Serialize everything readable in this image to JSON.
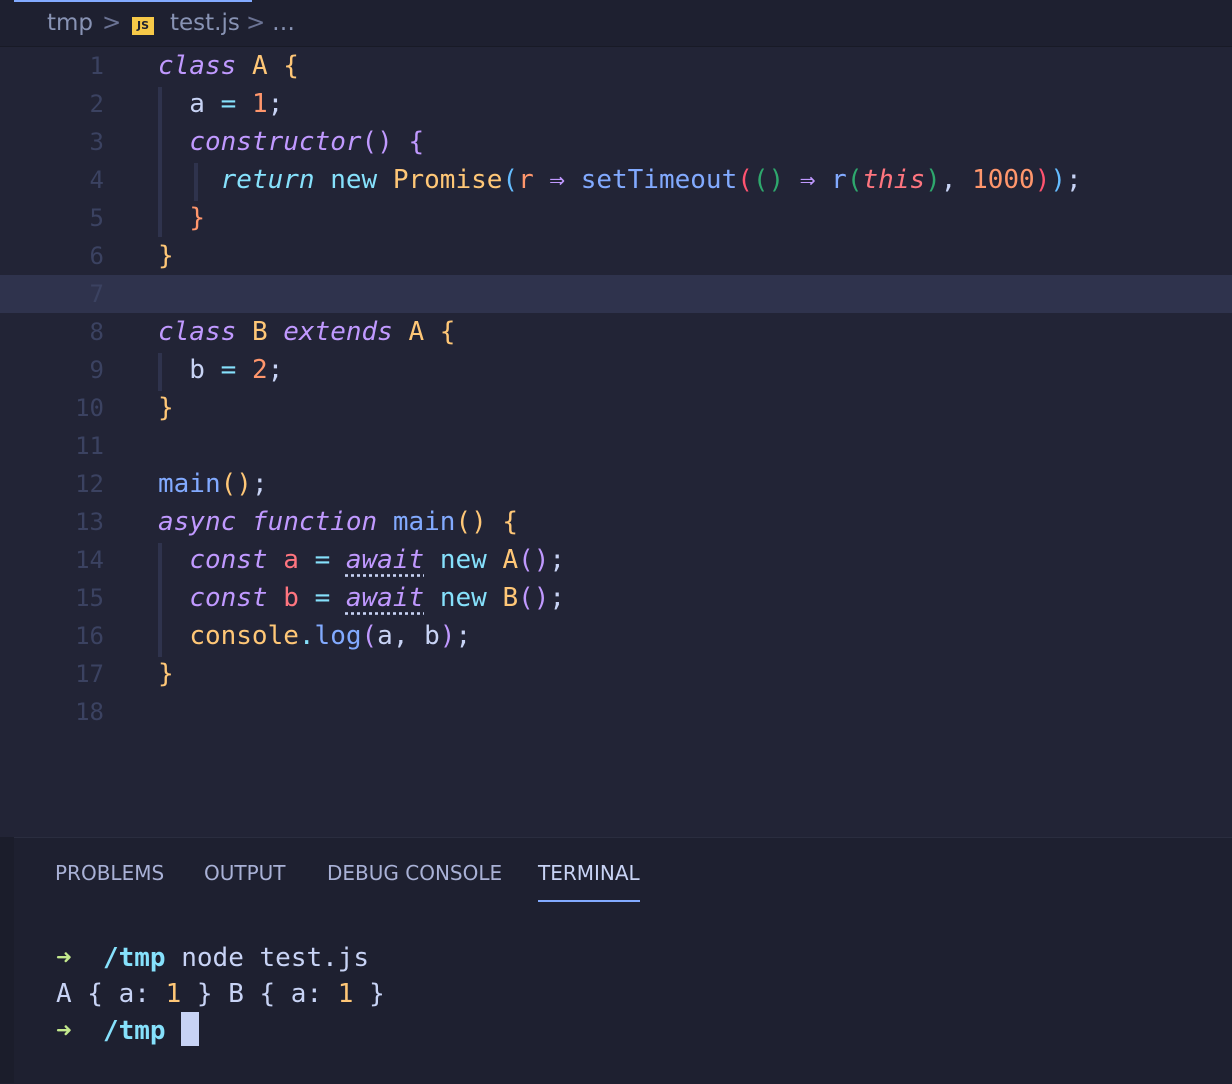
{
  "breadcrumb": {
    "folder": "tmp",
    "sep": ">",
    "file_icon": "JS",
    "file": "test.js",
    "more": "…"
  },
  "editor": {
    "line_numbers": [
      "1",
      "2",
      "3",
      "4",
      "5",
      "6",
      "7",
      "8",
      "9",
      "10",
      "11",
      "12",
      "13",
      "14",
      "15",
      "16",
      "17",
      "18"
    ],
    "current_line": 7,
    "code": {
      "l1": {
        "t1": "class",
        "t2": " ",
        "t3": "A",
        "t4": " ",
        "t5": "{"
      },
      "l2": {
        "t1": "  a ",
        "t2": "=",
        "t3": " ",
        "t4": "1",
        "t5": ";"
      },
      "l3": {
        "t1": "  ",
        "t2": "constructor",
        "t3": "(",
        "t4": ")",
        "t5": " ",
        "t6": "{"
      },
      "l4": {
        "t1": "    ",
        "t2": "return",
        "t3": " ",
        "t4": "new",
        "t5": " ",
        "t6": "Promise",
        "t7": "(",
        "t8": "r",
        "t9": " ",
        "t10": "⇒",
        "t11": " ",
        "t12": "setTimeout",
        "t13": "(",
        "t14": "(",
        "t15": ")",
        "t16": " ",
        "t17": "⇒",
        "t18": " ",
        "t19": "r",
        "t20": "(",
        "t21": "this",
        "t22": ")",
        "t23": ", ",
        "t24": "1000",
        "t25": ")",
        "t26": ")",
        "t27": ";"
      },
      "l5": {
        "t1": "  ",
        "t2": "}"
      },
      "l6": {
        "t1": "}"
      },
      "l8": {
        "t1": "class",
        "t2": " ",
        "t3": "B",
        "t4": " ",
        "t5": "extends",
        "t6": " ",
        "t7": "A",
        "t8": " ",
        "t9": "{"
      },
      "l9": {
        "t1": "  b ",
        "t2": "=",
        "t3": " ",
        "t4": "2",
        "t5": ";"
      },
      "l10": {
        "t1": "}"
      },
      "l12": {
        "t1": "main",
        "t2": "(",
        "t3": ")",
        "t4": ";"
      },
      "l13": {
        "t1": "async",
        "t2": " ",
        "t3": "function",
        "t4": " ",
        "t5": "main",
        "t6": "(",
        "t7": ")",
        "t8": " ",
        "t9": "{"
      },
      "l14": {
        "t1": "  ",
        "t2": "const",
        "t3": " ",
        "t4": "a",
        "t5": " ",
        "t6": "=",
        "t7": " ",
        "t8": "await",
        "t9": " ",
        "t10": "new",
        "t11": " ",
        "t12": "A",
        "t13": "(",
        "t14": ")",
        "t15": ";"
      },
      "l15": {
        "t1": "  ",
        "t2": "const",
        "t3": " ",
        "t4": "b",
        "t5": " ",
        "t6": "=",
        "t7": " ",
        "t8": "await",
        "t9": " ",
        "t10": "new",
        "t11": " ",
        "t12": "B",
        "t13": "(",
        "t14": ")",
        "t15": ";"
      },
      "l16": {
        "t1": "  ",
        "t2": "console",
        "t3": ".",
        "t4": "log",
        "t5": "(",
        "t6": "a, b",
        "t7": ")",
        "t8": ";"
      },
      "l17": {
        "t1": "}"
      }
    }
  },
  "panel": {
    "tabs": [
      "PROBLEMS",
      "OUTPUT",
      "DEBUG CONSOLE",
      "TERMINAL"
    ],
    "active_tab": "TERMINAL"
  },
  "terminal": {
    "prompt_arrow": "➜",
    "cwd": "/tmp",
    "command": "node test.js",
    "output": {
      "p1": "A { a: ",
      "p2": "1",
      "p3": " } B { a: ",
      "p4": "1",
      "p5": " }"
    }
  },
  "colors": {
    "background": "#222436",
    "keyword": "#c099ff",
    "class": "#ffc777",
    "function": "#82aaff",
    "number": "#ff966c",
    "prompt_arrow": "#c3e88d",
    "cwd": "#86e1fc"
  }
}
